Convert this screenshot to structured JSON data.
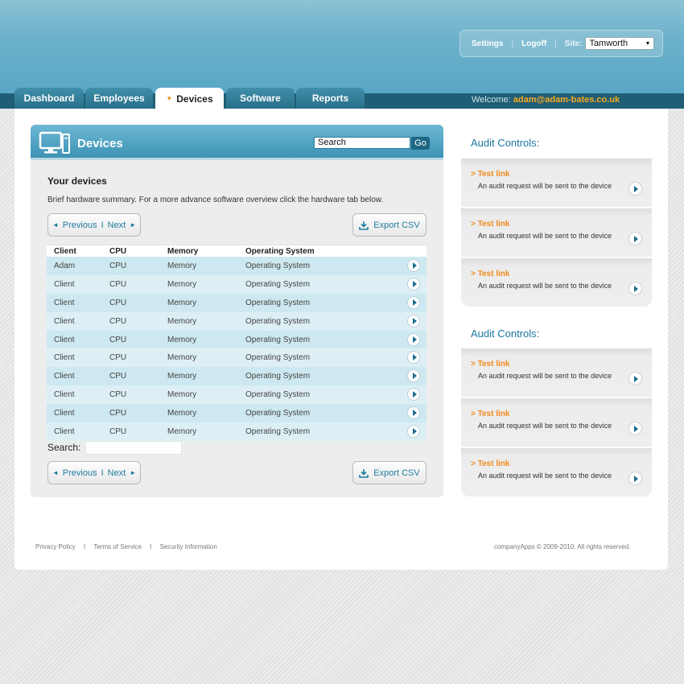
{
  "header": {
    "settings_label": "Settings",
    "logoff_label": "Logoff",
    "site_label": "Site:",
    "site_value": "Tamworth",
    "welcome_label": "Welcome:",
    "welcome_user": "adam@adam-bates.co.uk"
  },
  "tabs": [
    {
      "label": "Dashboard",
      "active": false
    },
    {
      "label": "Employees",
      "active": false
    },
    {
      "label": "Devices",
      "active": true
    },
    {
      "label": "Software",
      "active": false
    },
    {
      "label": "Reports",
      "active": false
    }
  ],
  "devices": {
    "title": "Devices",
    "search_value": "Search",
    "go_label": "Go",
    "heading": "Your devices",
    "summary": "Brief hardware summary. For a more advance software overview click the hardware tab below.",
    "previous_label": "Previous",
    "separator": "I",
    "next_label": "Next",
    "export_label": "Export CSV",
    "filter_label": "Search:",
    "columns": [
      "Client",
      "CPU",
      "Memory",
      "Operating System"
    ],
    "rows": [
      [
        "Adam",
        "CPU",
        "Memory",
        "Operating System"
      ],
      [
        "Client",
        "CPU",
        "Memory",
        "Operating System"
      ],
      [
        "Client",
        "CPU",
        "Memory",
        "Operating System"
      ],
      [
        "Client",
        "CPU",
        "Memory",
        "Operating System"
      ],
      [
        "Client",
        "CPU",
        "Memory",
        "Operating System"
      ],
      [
        "Client",
        "CPU",
        "Memory",
        "Operating System"
      ],
      [
        "Client",
        "CPU",
        "Memory",
        "Operating System"
      ],
      [
        "Client",
        "CPU",
        "Memory",
        "Operating System"
      ],
      [
        "Client",
        "CPU",
        "Memory",
        "Operating System"
      ],
      [
        "Client",
        "CPU",
        "Memory",
        "Operating System"
      ]
    ]
  },
  "audit_groups": [
    {
      "title": "Audit Controls:",
      "items": [
        {
          "link": "> Test link",
          "desc": "An audit request will be sent to the device"
        },
        {
          "link": "> Test link",
          "desc": "An audit request will be sent to the device"
        },
        {
          "link": "> Test link",
          "desc": "An audit request will be sent to the device"
        }
      ]
    },
    {
      "title": "Audit Controls:",
      "items": [
        {
          "link": "> Test link",
          "desc": "An audit request will be sent to the device"
        },
        {
          "link": "> Test link",
          "desc": "An audit request will be sent to the device"
        },
        {
          "link": "> Test link",
          "desc": "An audit request will be sent to the device"
        }
      ]
    }
  ],
  "footer": {
    "links": [
      "Privacy Policy",
      "Terms of Service",
      "Security Information"
    ],
    "separator": "I",
    "copyright": "companyApps © 2009-2010. All rights reserved."
  },
  "colors": {
    "accent_orange": "#f08a1c",
    "header_blue": "#58a7c6",
    "nav_dark": "#1f5e74",
    "link_blue": "#1f7c9f"
  }
}
